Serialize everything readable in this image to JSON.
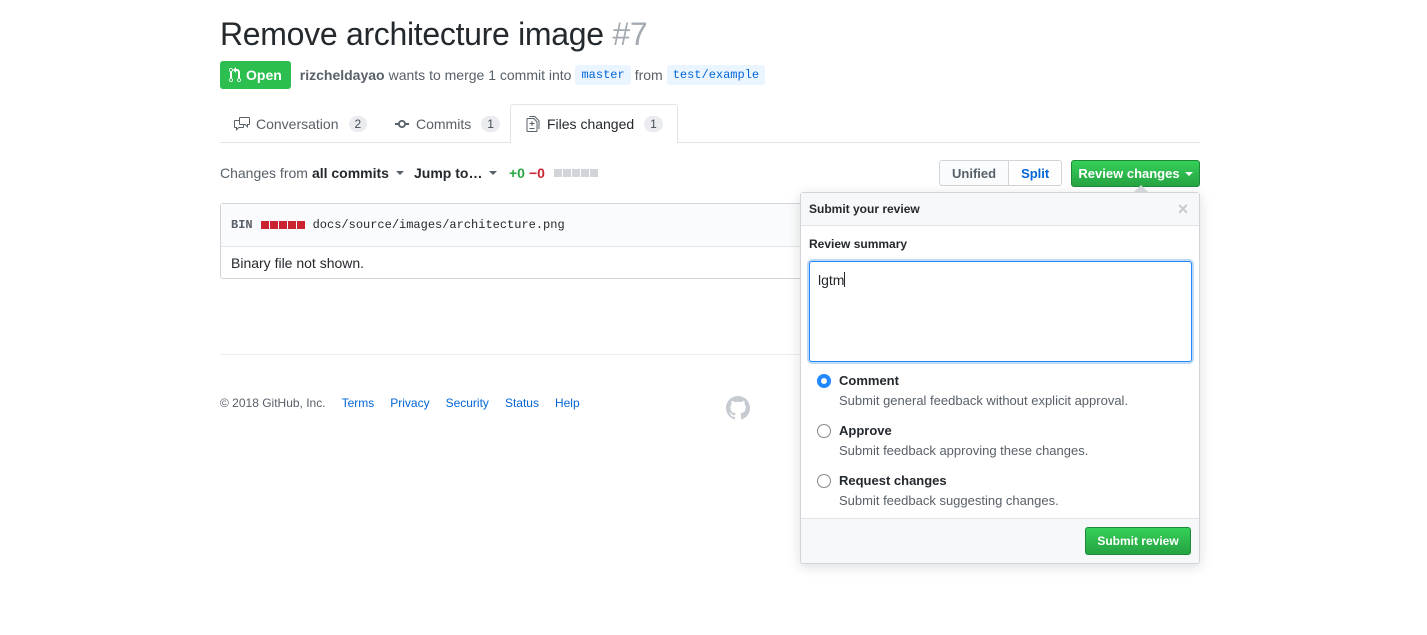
{
  "pr": {
    "title": "Remove architecture image",
    "number": "#7",
    "state": "Open",
    "author": "rizcheldayao",
    "merge_text": "wants to merge 1 commit into",
    "base_branch": "master",
    "from_text": "from",
    "head_branch": "test/example"
  },
  "tabs": [
    {
      "label": "Conversation",
      "count": "2",
      "icon": "comment-discussion-icon"
    },
    {
      "label": "Commits",
      "count": "1",
      "icon": "git-commit-icon"
    },
    {
      "label": "Files changed",
      "count": "1",
      "icon": "diff-icon"
    }
  ],
  "toolbar": {
    "changes_from_prefix": "Changes from",
    "changes_from_value": "all commits",
    "jump_to": "Jump to…",
    "additions": "+0",
    "deletions": "−0",
    "view_unified": "Unified",
    "view_split": "Split",
    "review_changes": "Review changes"
  },
  "file": {
    "bin_label": "BIN",
    "path": "docs/source/images/architecture.png",
    "body_text": "Binary file not shown."
  },
  "footer": {
    "copyright": "© 2018 GitHub, Inc.",
    "links": [
      "Terms",
      "Privacy",
      "Security",
      "Status",
      "Help"
    ]
  },
  "review_popup": {
    "header": "Submit your review",
    "close": "×",
    "summary_label": "Review summary",
    "summary_value": "lgtm",
    "options": [
      {
        "title": "Comment",
        "desc": "Submit general feedback without explicit approval.",
        "checked": true
      },
      {
        "title": "Approve",
        "desc": "Submit feedback approving these changes.",
        "checked": false
      },
      {
        "title": "Request changes",
        "desc": "Submit feedback suggesting changes.",
        "checked": false
      }
    ],
    "submit": "Submit review"
  },
  "colors": {
    "accent": "#0366d6",
    "success": "#28a745",
    "danger": "#cb2431"
  }
}
